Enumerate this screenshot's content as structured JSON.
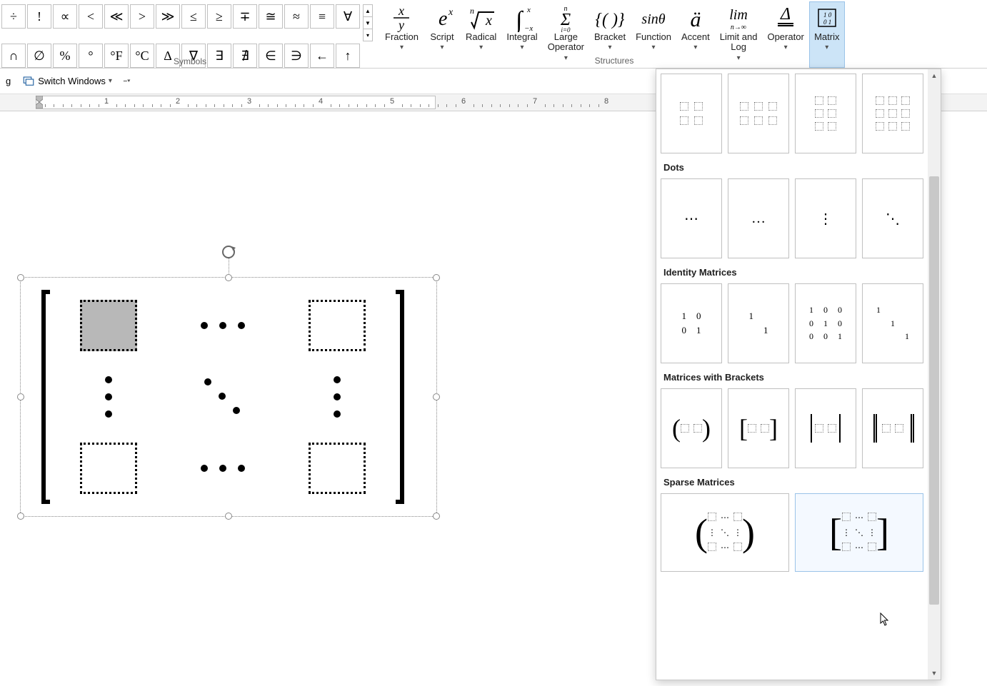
{
  "ribbon": {
    "group_symbols": "Symbols",
    "group_structures": "Structures",
    "symbols_row1": [
      "÷",
      "!",
      "∝",
      "<",
      "≪",
      ">",
      "≫",
      "≤",
      "≥",
      "∓",
      "≅",
      "≈",
      "≡",
      "∀"
    ],
    "symbols_row2": [
      "∩",
      "∅",
      "%",
      "°",
      "°F",
      "°C",
      "∆",
      "∇",
      "∃",
      "∄",
      "∈",
      "∋",
      "←",
      "↑"
    ],
    "structures": [
      {
        "id": "fraction",
        "label": "Fraction"
      },
      {
        "id": "script",
        "label": "Script"
      },
      {
        "id": "radical",
        "label": "Radical"
      },
      {
        "id": "integral",
        "label": "Integral"
      },
      {
        "id": "large-operator",
        "label": "Large\nOperator"
      },
      {
        "id": "bracket",
        "label": "Bracket"
      },
      {
        "id": "function",
        "label": "Function"
      },
      {
        "id": "accent",
        "label": "Accent"
      },
      {
        "id": "limit-log",
        "label": "Limit and\nLog"
      },
      {
        "id": "operator",
        "label": "Operator"
      },
      {
        "id": "matrix",
        "label": "Matrix"
      }
    ]
  },
  "subbar": {
    "switch_windows": "Switch Windows",
    "truncated_left": "g"
  },
  "ruler": {
    "labels": [
      "1",
      "2",
      "3",
      "4",
      "5",
      "6",
      "7",
      "8"
    ]
  },
  "gallery": {
    "sections": {
      "dots": "Dots",
      "identity": "Identity Matrices",
      "brackets": "Matrices with Brackets",
      "sparse": "Sparse Matrices"
    },
    "identity_2x2": [
      [
        "1",
        "0"
      ],
      [
        "0",
        "1"
      ]
    ],
    "identity_2x2_diag": [
      [
        "1",
        ""
      ],
      [
        "",
        "1"
      ]
    ],
    "identity_3x3": [
      [
        "1",
        "0",
        "0"
      ],
      [
        "0",
        "1",
        "0"
      ],
      [
        "0",
        "0",
        "1"
      ]
    ],
    "identity_3x3_diag": [
      [
        "1",
        "",
        ""
      ],
      [
        "",
        "1",
        ""
      ],
      [
        "",
        "",
        "1"
      ]
    ],
    "dot_items": [
      "⋯",
      "…",
      "⋮",
      "⋱"
    ]
  }
}
